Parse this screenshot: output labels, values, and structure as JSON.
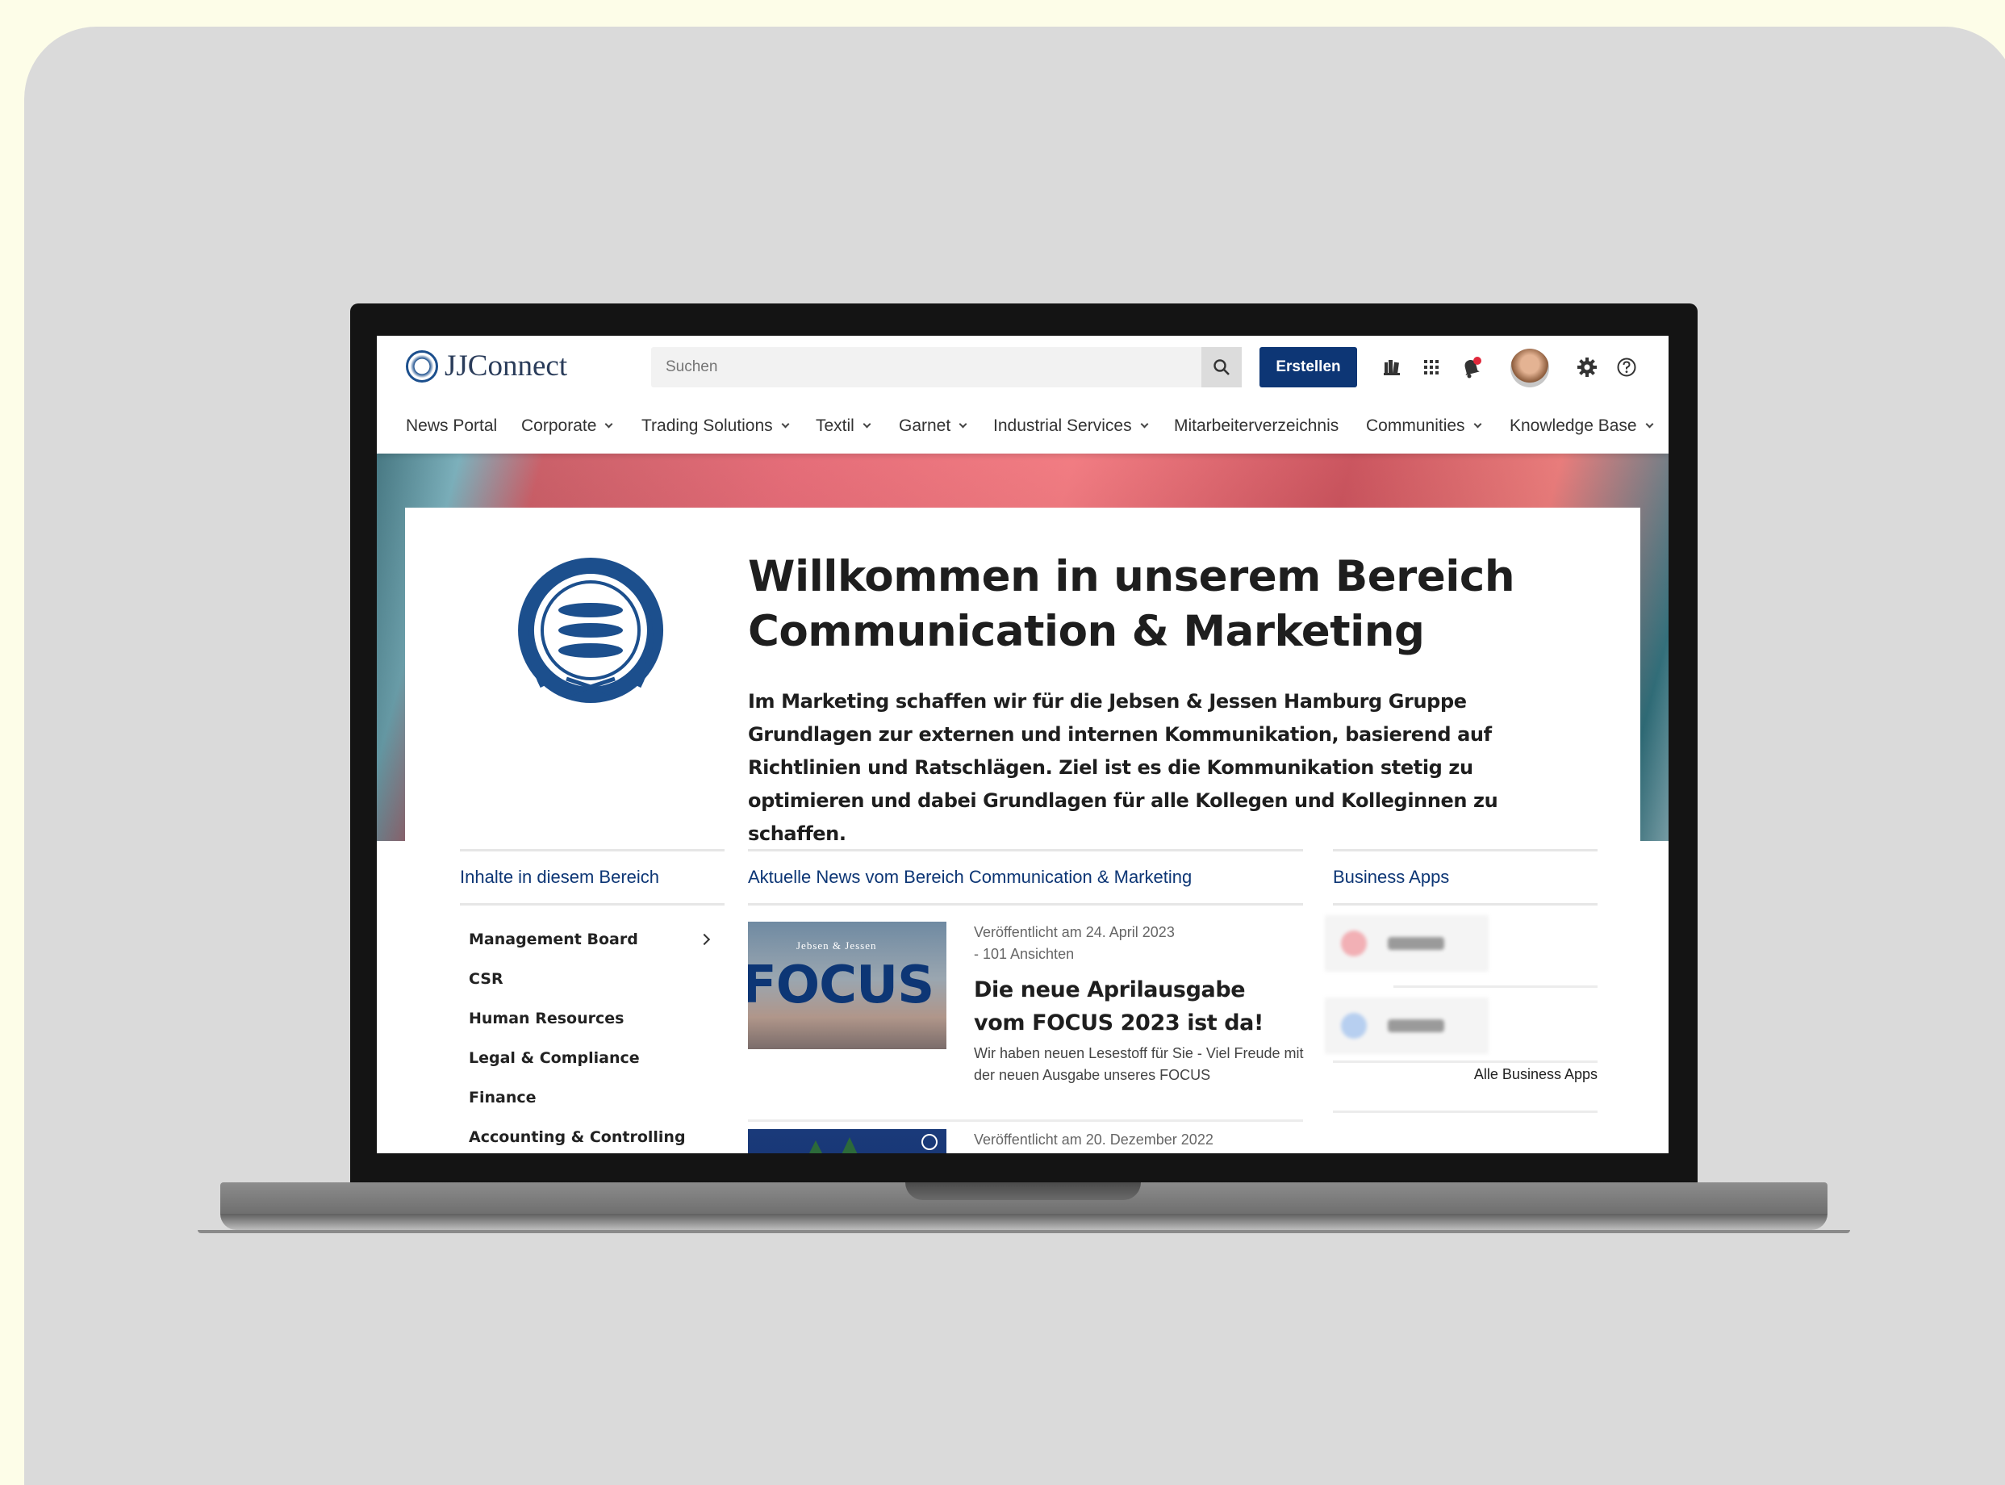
{
  "app": {
    "logo_text": "JJConnect",
    "search_placeholder": "Suchen",
    "create_label": "Erstellen"
  },
  "nav": [
    {
      "label": "News Portal",
      "dropdown": false
    },
    {
      "label": "Corporate",
      "dropdown": true
    },
    {
      "label": "Trading Solutions",
      "dropdown": true
    },
    {
      "label": "Textil",
      "dropdown": true
    },
    {
      "label": "Garnet",
      "dropdown": true
    },
    {
      "label": "Industrial Services",
      "dropdown": true
    },
    {
      "label": "Mitarbeiterverzeichnis",
      "dropdown": false
    },
    {
      "label": "Communities",
      "dropdown": true
    },
    {
      "label": "Knowledge Base",
      "dropdown": true
    }
  ],
  "header_icons": [
    "documents-icon",
    "app-grid-icon",
    "bell-icon",
    "avatar",
    "gear-icon",
    "help-icon"
  ],
  "colors": {
    "brand": "#0d3675",
    "notification": "#e0283b",
    "page_bg": "#fdfde8",
    "card_bg": "#dadada"
  },
  "page": {
    "title_line1": "Willkommen in unserem Bereich",
    "title_line2": "Communication & Marketing",
    "intro": "Im Marketing schaffen wir für die Jebsen & Jessen Hamburg Gruppe Grundlagen zur externen und internen Kommunikation, basierend auf Richtlinien und Ratschlägen. Ziel ist es die Kommunikation stetig zu optimieren und dabei Grundlagen für alle Kollegen und Kolleginnen zu schaffen."
  },
  "sidebar": {
    "heading": "Inhalte in diesem Bereich",
    "items": [
      {
        "label": "Management Board",
        "has_children": true
      },
      {
        "label": "CSR"
      },
      {
        "label": "Human Resources"
      },
      {
        "label": "Legal & Compliance"
      },
      {
        "label": "Finance"
      },
      {
        "label": "Accounting & Controlling"
      }
    ]
  },
  "news": {
    "heading": "Aktuelle News vom Bereich Communication & Marketing",
    "items": [
      {
        "meta_date": "Veröffentlicht am 24. April 2023",
        "meta_views": "- 101 Ansichten",
        "title": "Die neue Aprilausgabe vom FOCUS 2023 ist da!",
        "description": "Wir haben neuen Lesestoff für Sie - Viel Freude mit der neuen Ausgabe unseres FOCUS",
        "thumb_brand": "Jebsen & Jessen",
        "thumb_word": "FOCUS"
      },
      {
        "meta_date": "Veröffentlicht am 20. Dezember 2022",
        "meta_views": "",
        "title": "",
        "description": ""
      }
    ]
  },
  "apps": {
    "heading": "Business Apps",
    "all_label": "Alle Business Apps"
  }
}
